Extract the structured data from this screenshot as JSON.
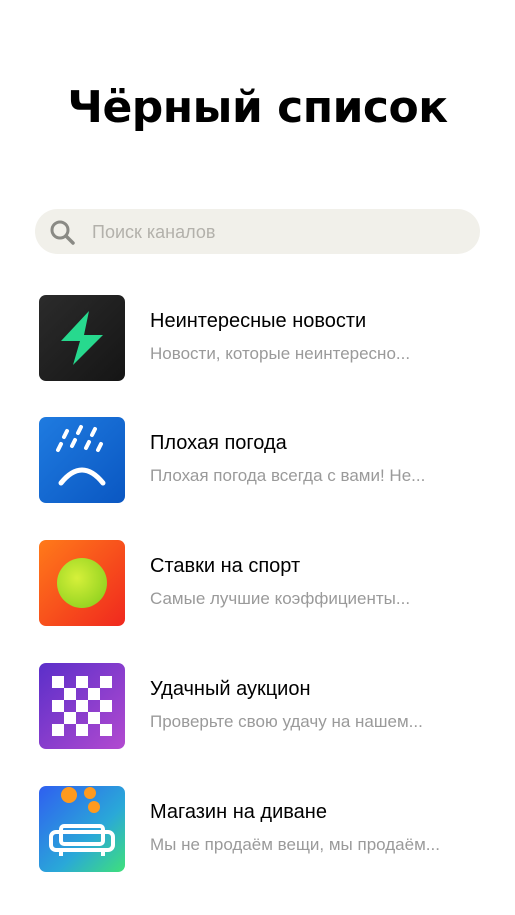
{
  "page": {
    "title": "Чёрный список"
  },
  "search": {
    "placeholder": "Поиск каналов"
  },
  "channels": [
    {
      "title": "Неинтересные новости",
      "description": "Новости, которые неинтересно...",
      "icon": "lightning-icon"
    },
    {
      "title": "Плохая погода",
      "description": "Плохая погода всегда с вами! Не...",
      "icon": "sad-rain-icon"
    },
    {
      "title": "Ставки на спорт",
      "description": "Самые лучшие коэффициенты...",
      "icon": "ball-icon"
    },
    {
      "title": "Удачный аукцион",
      "description": "Проверьте свою удачу на нашем...",
      "icon": "checkerboard-icon"
    },
    {
      "title": "Магазин на диване",
      "description": "Мы не продаём вещи, мы продаём...",
      "icon": "sofa-icon"
    }
  ],
  "colors": {
    "search_bg": "#f1f0ea",
    "secondary_text": "#9a9a9a",
    "accent_green": "#27d98e"
  }
}
